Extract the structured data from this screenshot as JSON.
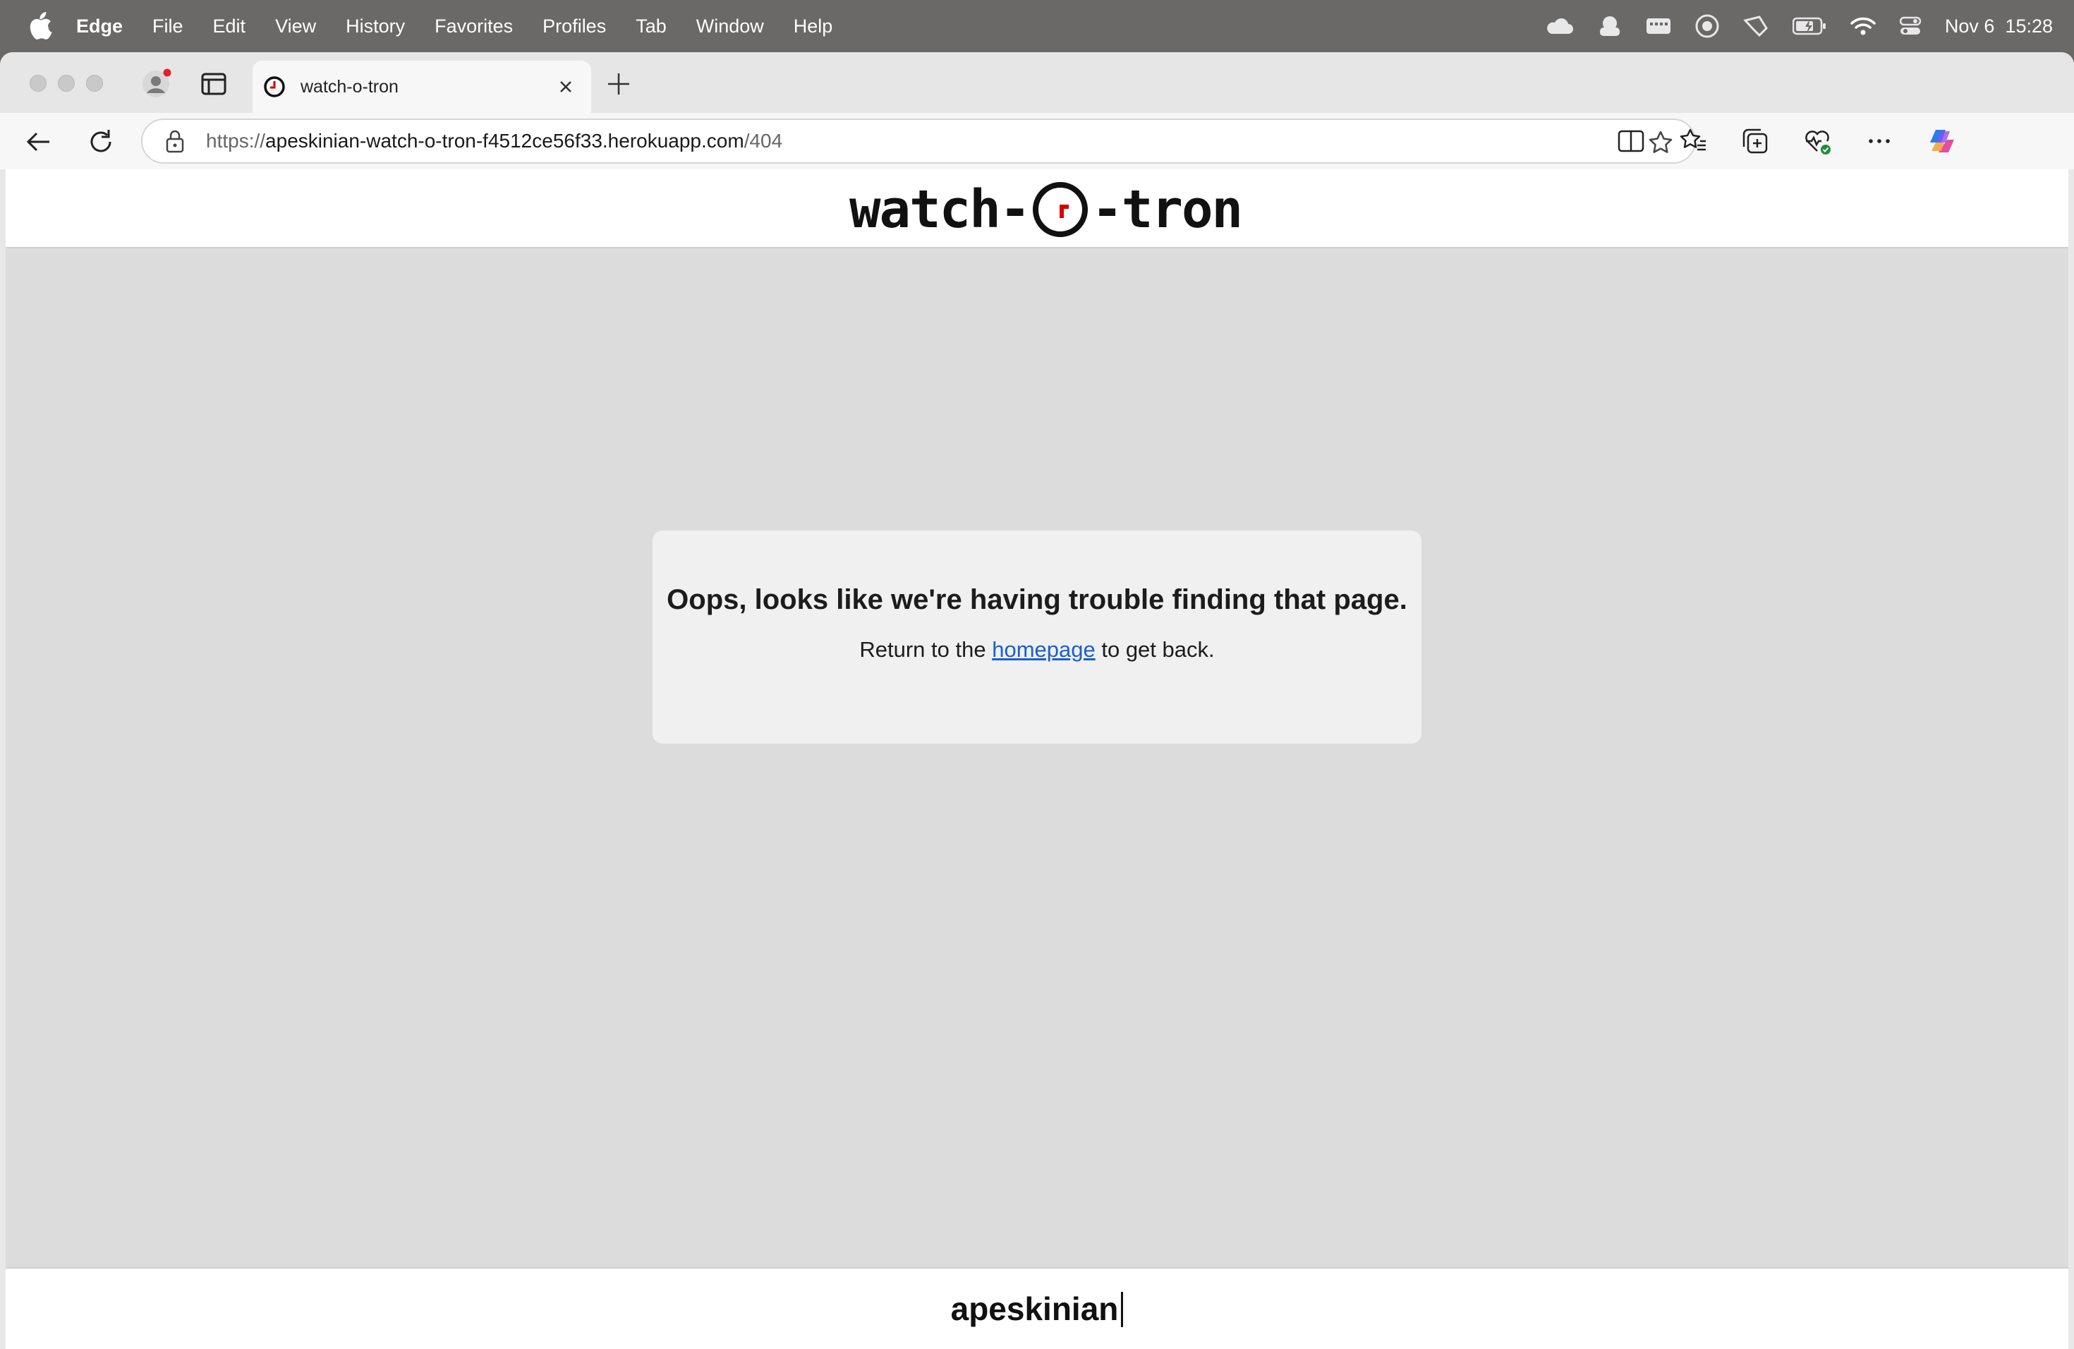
{
  "menubar": {
    "app": "Edge",
    "items": [
      "File",
      "Edit",
      "View",
      "History",
      "Favorites",
      "Profiles",
      "Tab",
      "Window",
      "Help"
    ],
    "datetime": "Nov 6  15:28"
  },
  "browser": {
    "tab_title": "watch-o-tron",
    "url_scheme": "https://",
    "url_host": "apeskinian-watch-o-tron-f4512ce56f33.herokuapp.com",
    "url_path": "/404"
  },
  "site": {
    "logo_left": "watch-",
    "logo_right": "-tron",
    "error_heading": "Oops, looks like we're having trouble finding that page.",
    "error_prefix": "Return to the ",
    "error_link": "homepage",
    "error_suffix": " to get back.",
    "footer_text": "apeskinian"
  },
  "colors": {
    "logo_hand": "#d40000",
    "link": "#1a5fcf",
    "page_bg": "#dcdcdc"
  }
}
